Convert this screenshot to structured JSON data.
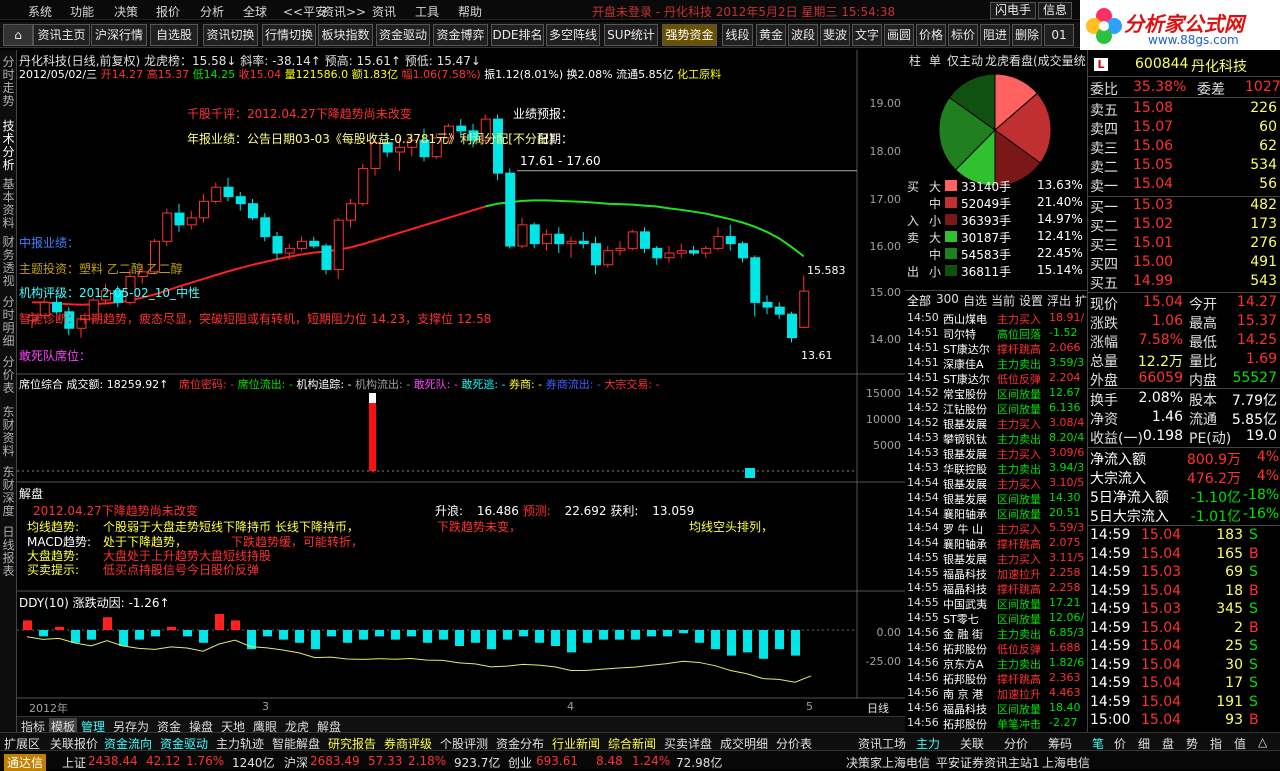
{
  "menu": {
    "items": [
      "系统",
      "功能",
      "决策",
      "报价",
      "分析",
      "全球",
      "<<平安",
      "资讯>>",
      "资讯",
      "工具",
      "帮助"
    ],
    "title_text": "开盘未登录 - 丹化科技 2012年5月2日 星期三 15:54:38",
    "btn_flash": "闪电手",
    "btn_info": "信息"
  },
  "logo": {
    "name": "分析家公式网",
    "url": "www.88gs.com"
  },
  "toolbar": [
    "资讯主页",
    "沪深行情",
    "自选股",
    "资讯切换",
    "行情切换",
    "板块指数",
    "资金驱动",
    "资金博弈",
    "DDE排名",
    "多空阵线",
    "SUP统计",
    "强势资金",
    "线段",
    "黄金",
    "波段",
    "斐波",
    "文字",
    "画圆",
    "价格",
    "标价",
    "阻进",
    "删除",
    "01"
  ],
  "lefttabs": [
    "分时走势",
    "技术分析",
    "基本资料",
    "财务透视",
    "分时明细",
    "分价表",
    "东财资料",
    "东财深度",
    "日线报表"
  ],
  "chart": {
    "header1": "丹化科技(日线,前复权) 龙虎榜：15.58↓  斜率: -38.14↑  预高: 15.61↑  预低: 15.47↓",
    "header2_date": "2012/05/02/三",
    "header2_open": "开14.27",
    "header2_high": "高15.37",
    "header2_low": "低14.25",
    "header2_close": "收15.04",
    "header2_vol": "量121586.0",
    "header2_amt": "额1.83亿",
    "header2_rng": "幅1.06(7.58%)",
    "header2_amp": "振1.12(8.01%)",
    "header2_turn": "换2.08%",
    "header2_float": "流通5.85亿",
    "header2_ind": "化工原料",
    "ann_qiangu": "千股千评：2012.04.27下降趋势尚未改变",
    "ann_yeji": "年报业绩：公告日期03-03《每股收益-0.3781元》利润分配[不分配]",
    "ann_yjyb": "业绩预报：",
    "ann_date": "日期：",
    "ann_range": "17.61 - 17.60",
    "ann_zhuli": "中报业绩：",
    "ann_gainian": "主题投资：塑料 乙二醇 乙二醇",
    "ann_jigou": "机构评级：2012-05-02_10_中性",
    "ann_zhenduan": "智能诊断：中期趋势，疲态尽显，突破短阻或有转机，短期阻力位 14.23，支撑位 12.58",
    "ann_gansi": "敢死队席位：",
    "price_hi_label": "15.583",
    "price_lo_label": "13.61",
    "y_labels": [
      "19.00",
      "18.00",
      "17.00",
      "16.00",
      "15.00",
      "14.00"
    ],
    "sub1_header": "席位综合 成交额: 18259.92↑",
    "sub1_items": [
      "席位密码: -",
      "席位流出: -",
      "机构追踪: -",
      "机构流出: -",
      "敢死队: -",
      "敢死逃: -",
      "券商: -",
      "券商流出: -",
      "大宗交易: -"
    ],
    "sub1_y": [
      "15000",
      "10000",
      "5000"
    ],
    "sub2_header": "解盘",
    "sub2_line1": "2012.04.27下降趋势尚未改变",
    "sub2_shengliang": "升浪:",
    "sub2_shengliang_v": "16.486",
    "sub2_yuce": "预测:",
    "sub2_yuce_v": "22.692",
    "sub2_huoli": "获利:",
    "sub2_huoli_v": "13.059",
    "sub2_rows": [
      {
        "k": "均线趋势:",
        "v": "个股弱于大盘走势短线下降持币 长线下降持币，",
        "x": "下跌趋势未变，",
        "y": "均线空头排列，"
      },
      {
        "k": "MACD趋势:",
        "v": "处于下降趋势，",
        "x": "下跌趋势缓，可能转折，",
        "y": ""
      },
      {
        "k": "大盘趋势:",
        "v": "大盘处于上升趋势大盘短线持股",
        "x": "",
        "y": ""
      },
      {
        "k": "买卖提示:",
        "v": "低买点持股信号今日股价反弹",
        "x": "",
        "y": ""
      }
    ],
    "sub3_header": "DDY(10) 涨跌动因: -1.26↑",
    "sub3_y": [
      "0.00",
      "-25.00"
    ],
    "x_labels": [
      "2012年",
      "3",
      "4",
      "5"
    ],
    "x_label_right": "日线"
  },
  "bottomtabs": [
    "指标",
    "模板",
    "管理",
    "另存为",
    "资金",
    "操盘",
    "天地",
    "鹰眼",
    "龙虎",
    "解盘"
  ],
  "funcbar": [
    "扩展区",
    "关联报价",
    "资金流向",
    "资金驱动",
    "主力轨迹",
    "智能解盘",
    "研究报告",
    "券商评级",
    "个股评测",
    "资金分布",
    "行业新闻",
    "综合新闻",
    "买卖详盘",
    "成交明细",
    "分价表",
    "资讯工场"
  ],
  "funcbar_right": [
    "主力",
    "关联",
    "分价",
    "筹码"
  ],
  "funcbar_far": [
    "笔",
    "价",
    "细",
    "盘",
    "势",
    "指",
    "值",
    "△"
  ],
  "status": {
    "sh_label": "上证",
    "sh_val": "2438.44",
    "sh_chg": "42.12",
    "sh_pct": "1.76%",
    "sh_amt": "1240亿",
    "hs_label": "沪深",
    "hs_val": "2683.49",
    "hs_chg": "57.33",
    "hs_pct": "2.18%",
    "hs_amt": "923.7亿",
    "cy_label": "创业",
    "cy_val": "693.61",
    "cy_chg": "8.48",
    "cy_pct": "1.24%",
    "cy_amt": "72.98亿",
    "broker": "决策家上海电信",
    "link": "平安证券资讯主站1",
    "isp": "上海电信"
  },
  "logo_box": "通达信",
  "right": {
    "tabs": [
      "柱",
      "单",
      "仅主动",
      "龙虎看盘(成交量统"
    ],
    "stock_code": "600844",
    "stock_name": "丹化科技",
    "flow": [
      {
        "side": "买",
        "size": "大",
        "val": "33140手",
        "pct": "13.63%",
        "color": "#ff6060"
      },
      {
        "side": "",
        "size": "中",
        "val": "52049手",
        "pct": "21.40%",
        "color": "#c03030"
      },
      {
        "side": "入",
        "size": "小",
        "val": "36393手",
        "pct": "14.97%",
        "color": "#7a1818"
      },
      {
        "side": "卖",
        "size": "大",
        "val": "30187手",
        "pct": "12.41%",
        "color": "#30c030"
      },
      {
        "side": "",
        "size": "中",
        "val": "54583手",
        "pct": "22.45%",
        "color": "#208020"
      },
      {
        "side": "出",
        "size": "小",
        "val": "36811手",
        "pct": "15.14%",
        "color": "#105010"
      }
    ],
    "list_tabs": [
      "全部",
      "300",
      "自选",
      "当前",
      "设置",
      "浮出",
      "扩"
    ],
    "list": [
      {
        "t": "14:50",
        "n": "西山煤电",
        "s": "主力买入",
        "v": "18.91/",
        "c": "red"
      },
      {
        "t": "14:51",
        "n": "司尔特",
        "s": "高位回落",
        "v": "-1.52",
        "c": "green"
      },
      {
        "t": "14:51",
        "n": "ST康达尔",
        "s": "撑杆跳高",
        "v": "2.066",
        "c": "red"
      },
      {
        "t": "14:51",
        "n": "深康佳A",
        "s": "主力卖出",
        "v": "3.59/3",
        "c": "green"
      },
      {
        "t": "14:51",
        "n": "ST康达尔",
        "s": "低位反弹",
        "v": "2.204",
        "c": "red"
      },
      {
        "t": "14:52",
        "n": "常宝股份",
        "s": "区间放量",
        "v": "12.67",
        "c": "green"
      },
      {
        "t": "14:52",
        "n": "江钻股份",
        "s": "区间放量",
        "v": "6.136",
        "c": "green"
      },
      {
        "t": "14:52",
        "n": "银基发展",
        "s": "主力买入",
        "v": "3.08/4",
        "c": "red"
      },
      {
        "t": "14:53",
        "n": "攀钢钒钛",
        "s": "主力卖出",
        "v": "8.20/4",
        "c": "green"
      },
      {
        "t": "14:53",
        "n": "银基发展",
        "s": "主力买入",
        "v": "3.09/6",
        "c": "red"
      },
      {
        "t": "14:53",
        "n": "华联控股",
        "s": "主力卖出",
        "v": "3.94/3",
        "c": "green"
      },
      {
        "t": "14:54",
        "n": "银基发展",
        "s": "主力买入",
        "v": "3.10/5",
        "c": "red"
      },
      {
        "t": "14:54",
        "n": "银基发展",
        "s": "区间放量",
        "v": "14.30",
        "c": "green"
      },
      {
        "t": "14:54",
        "n": "襄阳轴承",
        "s": "区间放量",
        "v": "20.51",
        "c": "green"
      },
      {
        "t": "14:54",
        "n": "罗 牛 山",
        "s": "主力买入",
        "v": "5.59/3",
        "c": "red"
      },
      {
        "t": "14:54",
        "n": "襄阳轴承",
        "s": "撑杆跳高",
        "v": "2.075",
        "c": "red"
      },
      {
        "t": "14:55",
        "n": "银基发展",
        "s": "主力买入",
        "v": "3.11/5",
        "c": "red"
      },
      {
        "t": "14:55",
        "n": "福晶科技",
        "s": "加速拉升",
        "v": "2.258",
        "c": "red"
      },
      {
        "t": "14:55",
        "n": "福晶科技",
        "s": "撑杆跳高",
        "v": "2.258",
        "c": "red"
      },
      {
        "t": "14:55",
        "n": "中国武夷",
        "s": "区间放量",
        "v": "17.21",
        "c": "green"
      },
      {
        "t": "14:55",
        "n": "ST零七",
        "s": "区间放量",
        "v": "12.06/",
        "c": "green"
      },
      {
        "t": "14:56",
        "n": "金 融 街",
        "s": "主力卖出",
        "v": "6.85/3",
        "c": "green"
      },
      {
        "t": "14:56",
        "n": "拓邦股份",
        "s": "低位反弹",
        "v": "1.688",
        "c": "red"
      },
      {
        "t": "14:56",
        "n": "京东方A",
        "s": "主力卖出",
        "v": "1.82/6",
        "c": "green"
      },
      {
        "t": "14:56",
        "n": "拓邦股份",
        "s": "撑杆跳高",
        "v": "2.363",
        "c": "red"
      },
      {
        "t": "14:56",
        "n": "南 京 港",
        "s": "加速拉升",
        "v": "4.463",
        "c": "red"
      },
      {
        "t": "14:56",
        "n": "福晶科技",
        "s": "区间放量",
        "v": "18.40",
        "c": "green"
      },
      {
        "t": "14:56",
        "n": "拓邦股份",
        "s": "单笔冲击",
        "v": "-2.27",
        "c": "green"
      }
    ],
    "order": {
      "wb_label": "委比",
      "wb_val": "35.38%",
      "wc_label": "委差",
      "wc_val": "1027"
    },
    "sells": [
      {
        "l": "卖五",
        "p": "15.08",
        "v": "226"
      },
      {
        "l": "卖四",
        "p": "15.07",
        "v": "60"
      },
      {
        "l": "卖三",
        "p": "15.06",
        "v": "62"
      },
      {
        "l": "卖二",
        "p": "15.05",
        "v": "534"
      },
      {
        "l": "卖一",
        "p": "15.04",
        "v": "56"
      }
    ],
    "buys": [
      {
        "l": "买一",
        "p": "15.03",
        "v": "482"
      },
      {
        "l": "买二",
        "p": "15.02",
        "v": "173"
      },
      {
        "l": "买三",
        "p": "15.01",
        "v": "276"
      },
      {
        "l": "买四",
        "p": "15.00",
        "v": "491"
      },
      {
        "l": "买五",
        "p": "14.99",
        "v": "543"
      }
    ],
    "quote": [
      {
        "l1": "现价",
        "v1": "15.04",
        "c1": "red",
        "l2": "今开",
        "v2": "14.27",
        "c2": "red"
      },
      {
        "l1": "涨跌",
        "v1": "1.06",
        "c1": "red",
        "l2": "最高",
        "v2": "15.37",
        "c2": "red"
      },
      {
        "l1": "涨幅",
        "v1": "7.58%",
        "c1": "red",
        "l2": "最低",
        "v2": "14.25",
        "c2": "red"
      },
      {
        "l1": "总量",
        "v1": "12.2万",
        "c1": "yel",
        "l2": "量比",
        "v2": "1.69",
        "c2": "red"
      },
      {
        "l1": "外盘",
        "v1": "66059",
        "c1": "red",
        "l2": "内盘",
        "v2": "55527",
        "c2": "green"
      }
    ],
    "quote2": [
      {
        "l1": "换手",
        "v1": "2.08%",
        "l2": "股本",
        "v2": "7.79亿"
      },
      {
        "l1": "净资",
        "v1": "1.46",
        "l2": "流通",
        "v2": "5.85亿"
      },
      {
        "l1": "收益(一)",
        "v1": "0.198",
        "l2": "PE(动)",
        "v2": "19.0"
      }
    ],
    "flows": [
      {
        "l": "净流入额",
        "v": "800.9万",
        "p": "4%",
        "c": "red"
      },
      {
        "l": "大宗流入",
        "v": "476.2万",
        "p": "4%",
        "c": "red"
      },
      {
        "l": "5日净流入额",
        "v": "-1.10亿",
        "p": "-18%",
        "c": "green"
      },
      {
        "l": "5日大宗流入",
        "v": "-1.01亿",
        "p": "-16%",
        "c": "green"
      }
    ],
    "ticks": [
      {
        "t": "14:59",
        "p": "15.04",
        "v": "183",
        "d": "S",
        "c": "green"
      },
      {
        "t": "14:59",
        "p": "15.04",
        "v": "165",
        "d": "B",
        "c": "red"
      },
      {
        "t": "14:59",
        "p": "15.03",
        "v": "69",
        "d": "S",
        "c": "green"
      },
      {
        "t": "14:59",
        "p": "15.04",
        "v": "18",
        "d": "B",
        "c": "red"
      },
      {
        "t": "14:59",
        "p": "15.03",
        "v": "345",
        "d": "S",
        "c": "green"
      },
      {
        "t": "14:59",
        "p": "15.04",
        "v": "2",
        "d": "B",
        "c": "red"
      },
      {
        "t": "14:59",
        "p": "15.04",
        "v": "25",
        "d": "S",
        "c": "green"
      },
      {
        "t": "14:59",
        "p": "15.04",
        "v": "30",
        "d": "S",
        "c": "green"
      },
      {
        "t": "14:59",
        "p": "15.04",
        "v": "17",
        "d": "S",
        "c": "green"
      },
      {
        "t": "14:59",
        "p": "15.04",
        "v": "191",
        "d": "S",
        "c": "green"
      },
      {
        "t": "15:00",
        "p": "15.04",
        "v": "93",
        "d": "B",
        "c": "red"
      }
    ]
  },
  "chart_data": {
    "type": "candlestick",
    "candles": [
      [
        14.42,
        14.6,
        14.25,
        14.52
      ],
      [
        14.52,
        14.9,
        14.45,
        14.8
      ],
      [
        14.8,
        14.95,
        14.55,
        14.6
      ],
      [
        14.6,
        14.7,
        14.1,
        14.25
      ],
      [
        14.25,
        14.5,
        14.05,
        14.45
      ],
      [
        14.45,
        14.9,
        14.35,
        14.85
      ],
      [
        14.85,
        15.2,
        14.75,
        15.05
      ],
      [
        15.05,
        15.15,
        14.7,
        14.8
      ],
      [
        14.8,
        15.5,
        14.75,
        15.35
      ],
      [
        15.35,
        15.6,
        15.2,
        15.45
      ],
      [
        15.45,
        16.15,
        15.4,
        16.1
      ],
      [
        16.1,
        16.8,
        16.0,
        16.7
      ],
      [
        16.7,
        16.9,
        16.3,
        16.45
      ],
      [
        16.45,
        16.75,
        16.35,
        16.6
      ],
      [
        16.6,
        17.1,
        16.5,
        16.95
      ],
      [
        16.95,
        17.35,
        16.9,
        17.25
      ],
      [
        17.25,
        17.45,
        16.95,
        17.05
      ],
      [
        17.05,
        17.15,
        16.75,
        16.9
      ],
      [
        16.9,
        17.0,
        16.55,
        16.6
      ],
      [
        16.6,
        16.7,
        16.1,
        16.2
      ],
      [
        16.2,
        16.3,
        15.7,
        15.85
      ],
      [
        15.85,
        16.05,
        15.7,
        15.95
      ],
      [
        15.95,
        16.2,
        15.9,
        16.1
      ],
      [
        16.1,
        16.2,
        15.95,
        16.0
      ],
      [
        16.0,
        16.05,
        15.4,
        15.5
      ],
      [
        15.5,
        16.6,
        15.3,
        16.55
      ],
      [
        16.55,
        17.0,
        16.4,
        16.9
      ],
      [
        16.9,
        17.75,
        16.85,
        17.65
      ],
      [
        17.65,
        18.3,
        17.5,
        18.2
      ],
      [
        18.2,
        18.4,
        17.9,
        18.0
      ],
      [
        18.0,
        18.3,
        17.6,
        18.1
      ],
      [
        18.1,
        18.4,
        17.9,
        18.25
      ],
      [
        18.25,
        18.5,
        17.8,
        17.9
      ],
      [
        17.9,
        18.4,
        17.85,
        18.3
      ],
      [
        18.3,
        18.6,
        18.2,
        18.55
      ],
      [
        18.55,
        18.7,
        18.3,
        18.45
      ],
      [
        18.45,
        18.6,
        18.1,
        18.25
      ],
      [
        18.25,
        18.8,
        18.2,
        18.7
      ],
      [
        18.7,
        18.8,
        17.4,
        17.55
      ],
      [
        17.55,
        17.65,
        15.95,
        16.0
      ],
      [
        16.0,
        16.6,
        15.95,
        16.45
      ],
      [
        16.45,
        16.5,
        15.95,
        16.05
      ],
      [
        16.05,
        16.35,
        15.9,
        16.25
      ],
      [
        16.25,
        16.4,
        15.85,
        16.05
      ],
      [
        16.05,
        16.2,
        15.75,
        16.1
      ],
      [
        16.1,
        16.3,
        15.95,
        16.05
      ],
      [
        16.05,
        16.2,
        15.4,
        15.6
      ],
      [
        15.6,
        16.0,
        15.55,
        15.9
      ],
      [
        15.9,
        16.1,
        15.8,
        15.95
      ],
      [
        15.95,
        16.35,
        15.9,
        16.3
      ],
      [
        16.3,
        16.4,
        15.85,
        15.95
      ],
      [
        15.95,
        16.0,
        15.6,
        15.75
      ],
      [
        15.75,
        16.0,
        15.65,
        15.85
      ],
      [
        15.85,
        16.05,
        15.75,
        15.9
      ],
      [
        15.9,
        16.0,
        15.8,
        15.85
      ],
      [
        15.85,
        16.0,
        15.75,
        15.95
      ],
      [
        15.95,
        16.4,
        15.9,
        16.2
      ],
      [
        16.2,
        16.45,
        15.9,
        16.05
      ],
      [
        16.05,
        16.1,
        15.65,
        15.75
      ],
      [
        15.75,
        15.8,
        14.5,
        14.8
      ],
      [
        14.8,
        14.95,
        14.55,
        14.7
      ],
      [
        14.7,
        14.8,
        14.45,
        14.55
      ],
      [
        14.55,
        14.6,
        13.95,
        14.05
      ],
      [
        14.27,
        15.37,
        14.25,
        15.04
      ]
    ],
    "ma": [
      14.8,
      14.8,
      14.78,
      14.76,
      14.75,
      14.76,
      14.78,
      14.8,
      14.84,
      14.9,
      14.97,
      15.05,
      15.14,
      15.22,
      15.3,
      15.38,
      15.46,
      15.53,
      15.6,
      15.66,
      15.72,
      15.77,
      15.82,
      15.86,
      15.88,
      15.92,
      15.97,
      16.04,
      16.12,
      16.2,
      16.28,
      16.36,
      16.44,
      16.52,
      16.6,
      16.68,
      16.76,
      16.84,
      16.9,
      16.93,
      16.96,
      16.97,
      16.97,
      16.96,
      16.95,
      16.94,
      16.92,
      16.9,
      16.89,
      16.88,
      16.86,
      16.84,
      16.8,
      16.77,
      16.73,
      16.69,
      16.63,
      16.57,
      16.5,
      16.41,
      16.3,
      16.16,
      15.98,
      15.78
    ],
    "ylim": [
      13.5,
      19.3
    ],
    "sub1_bar": {
      "index": 46,
      "value": 16000
    },
    "sub1_small": {
      "index": 98,
      "value": 1000
    },
    "ddy": [
      3,
      -2,
      1,
      -4,
      -3,
      4,
      -5,
      -3,
      -2,
      1,
      -2,
      -4,
      5,
      3,
      -6,
      -2,
      -3,
      -4,
      -6,
      -2,
      -4,
      -3,
      -2,
      -3,
      -2,
      -4,
      -3,
      -5,
      -4,
      -6,
      -3,
      -2,
      -4,
      -5,
      -7,
      -4,
      -3,
      -3,
      -3,
      -2,
      -2,
      -1,
      -4,
      -6,
      -8,
      -7,
      -9,
      -6,
      -8,
      0
    ]
  }
}
